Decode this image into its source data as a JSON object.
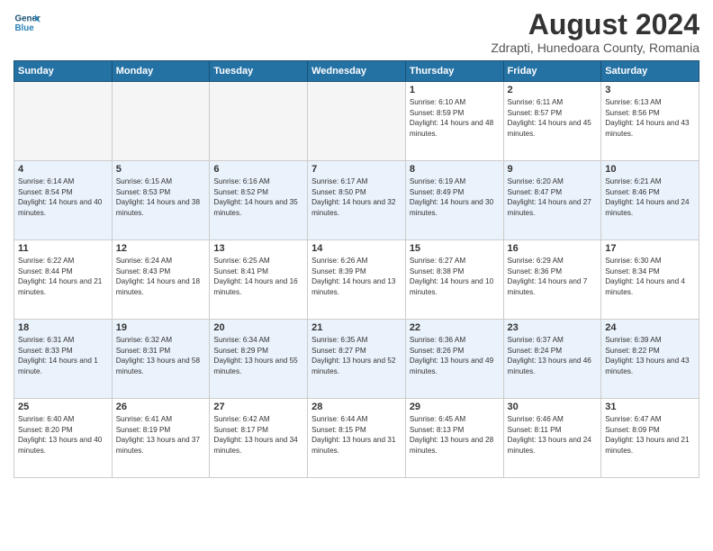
{
  "header": {
    "logo_line1": "General",
    "logo_line2": "Blue",
    "title": "August 2024",
    "subtitle": "Zdrapti, Hunedoara County, Romania"
  },
  "days_of_week": [
    "Sunday",
    "Monday",
    "Tuesday",
    "Wednesday",
    "Thursday",
    "Friday",
    "Saturday"
  ],
  "weeks": [
    [
      {
        "day": "",
        "empty": true
      },
      {
        "day": "",
        "empty": true
      },
      {
        "day": "",
        "empty": true
      },
      {
        "day": "",
        "empty": true
      },
      {
        "day": "1",
        "sunrise": "6:10 AM",
        "sunset": "8:59 PM",
        "hours": "14 hours and 48 minutes."
      },
      {
        "day": "2",
        "sunrise": "6:11 AM",
        "sunset": "8:57 PM",
        "hours": "14 hours and 45 minutes."
      },
      {
        "day": "3",
        "sunrise": "6:13 AM",
        "sunset": "8:56 PM",
        "hours": "14 hours and 43 minutes."
      }
    ],
    [
      {
        "day": "4",
        "sunrise": "6:14 AM",
        "sunset": "8:54 PM",
        "hours": "14 hours and 40 minutes."
      },
      {
        "day": "5",
        "sunrise": "6:15 AM",
        "sunset": "8:53 PM",
        "hours": "14 hours and 38 minutes."
      },
      {
        "day": "6",
        "sunrise": "6:16 AM",
        "sunset": "8:52 PM",
        "hours": "14 hours and 35 minutes."
      },
      {
        "day": "7",
        "sunrise": "6:17 AM",
        "sunset": "8:50 PM",
        "hours": "14 hours and 32 minutes."
      },
      {
        "day": "8",
        "sunrise": "6:19 AM",
        "sunset": "8:49 PM",
        "hours": "14 hours and 30 minutes."
      },
      {
        "day": "9",
        "sunrise": "6:20 AM",
        "sunset": "8:47 PM",
        "hours": "14 hours and 27 minutes."
      },
      {
        "day": "10",
        "sunrise": "6:21 AM",
        "sunset": "8:46 PM",
        "hours": "14 hours and 24 minutes."
      }
    ],
    [
      {
        "day": "11",
        "sunrise": "6:22 AM",
        "sunset": "8:44 PM",
        "hours": "14 hours and 21 minutes."
      },
      {
        "day": "12",
        "sunrise": "6:24 AM",
        "sunset": "8:43 PM",
        "hours": "14 hours and 18 minutes."
      },
      {
        "day": "13",
        "sunrise": "6:25 AM",
        "sunset": "8:41 PM",
        "hours": "14 hours and 16 minutes."
      },
      {
        "day": "14",
        "sunrise": "6:26 AM",
        "sunset": "8:39 PM",
        "hours": "14 hours and 13 minutes."
      },
      {
        "day": "15",
        "sunrise": "6:27 AM",
        "sunset": "8:38 PM",
        "hours": "14 hours and 10 minutes."
      },
      {
        "day": "16",
        "sunrise": "6:29 AM",
        "sunset": "8:36 PM",
        "hours": "14 hours and 7 minutes."
      },
      {
        "day": "17",
        "sunrise": "6:30 AM",
        "sunset": "8:34 PM",
        "hours": "14 hours and 4 minutes."
      }
    ],
    [
      {
        "day": "18",
        "sunrise": "6:31 AM",
        "sunset": "8:33 PM",
        "hours": "14 hours and 1 minute."
      },
      {
        "day": "19",
        "sunrise": "6:32 AM",
        "sunset": "8:31 PM",
        "hours": "13 hours and 58 minutes."
      },
      {
        "day": "20",
        "sunrise": "6:34 AM",
        "sunset": "8:29 PM",
        "hours": "13 hours and 55 minutes."
      },
      {
        "day": "21",
        "sunrise": "6:35 AM",
        "sunset": "8:27 PM",
        "hours": "13 hours and 52 minutes."
      },
      {
        "day": "22",
        "sunrise": "6:36 AM",
        "sunset": "8:26 PM",
        "hours": "13 hours and 49 minutes."
      },
      {
        "day": "23",
        "sunrise": "6:37 AM",
        "sunset": "8:24 PM",
        "hours": "13 hours and 46 minutes."
      },
      {
        "day": "24",
        "sunrise": "6:39 AM",
        "sunset": "8:22 PM",
        "hours": "13 hours and 43 minutes."
      }
    ],
    [
      {
        "day": "25",
        "sunrise": "6:40 AM",
        "sunset": "8:20 PM",
        "hours": "13 hours and 40 minutes."
      },
      {
        "day": "26",
        "sunrise": "6:41 AM",
        "sunset": "8:19 PM",
        "hours": "13 hours and 37 minutes."
      },
      {
        "day": "27",
        "sunrise": "6:42 AM",
        "sunset": "8:17 PM",
        "hours": "13 hours and 34 minutes."
      },
      {
        "day": "28",
        "sunrise": "6:44 AM",
        "sunset": "8:15 PM",
        "hours": "13 hours and 31 minutes."
      },
      {
        "day": "29",
        "sunrise": "6:45 AM",
        "sunset": "8:13 PM",
        "hours": "13 hours and 28 minutes."
      },
      {
        "day": "30",
        "sunrise": "6:46 AM",
        "sunset": "8:11 PM",
        "hours": "13 hours and 24 minutes."
      },
      {
        "day": "31",
        "sunrise": "6:47 AM",
        "sunset": "8:09 PM",
        "hours": "13 hours and 21 minutes."
      }
    ]
  ]
}
